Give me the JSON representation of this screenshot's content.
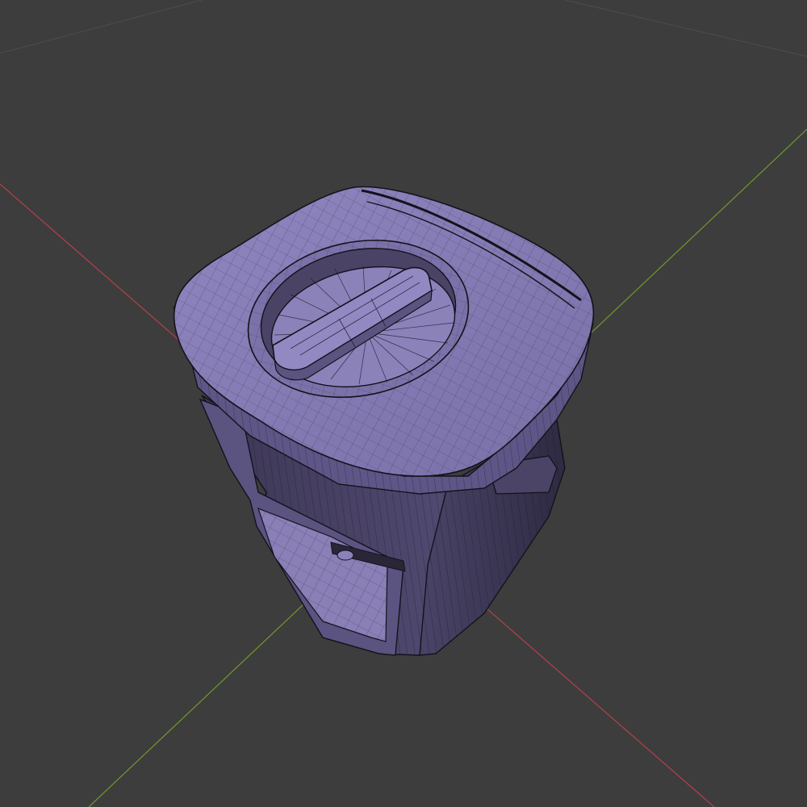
{
  "viewport": {
    "background": "#3d3d3d",
    "grid_color": "#4a4a4a",
    "x_axis_color": "#b3414a",
    "y_axis_color": "#6e9a2c",
    "mesh_fill": "#8a7fb6",
    "mesh_shadow": "#4a4366",
    "wire_color": "#1b1826",
    "object": "wireframe-mesh-box-appliance"
  }
}
